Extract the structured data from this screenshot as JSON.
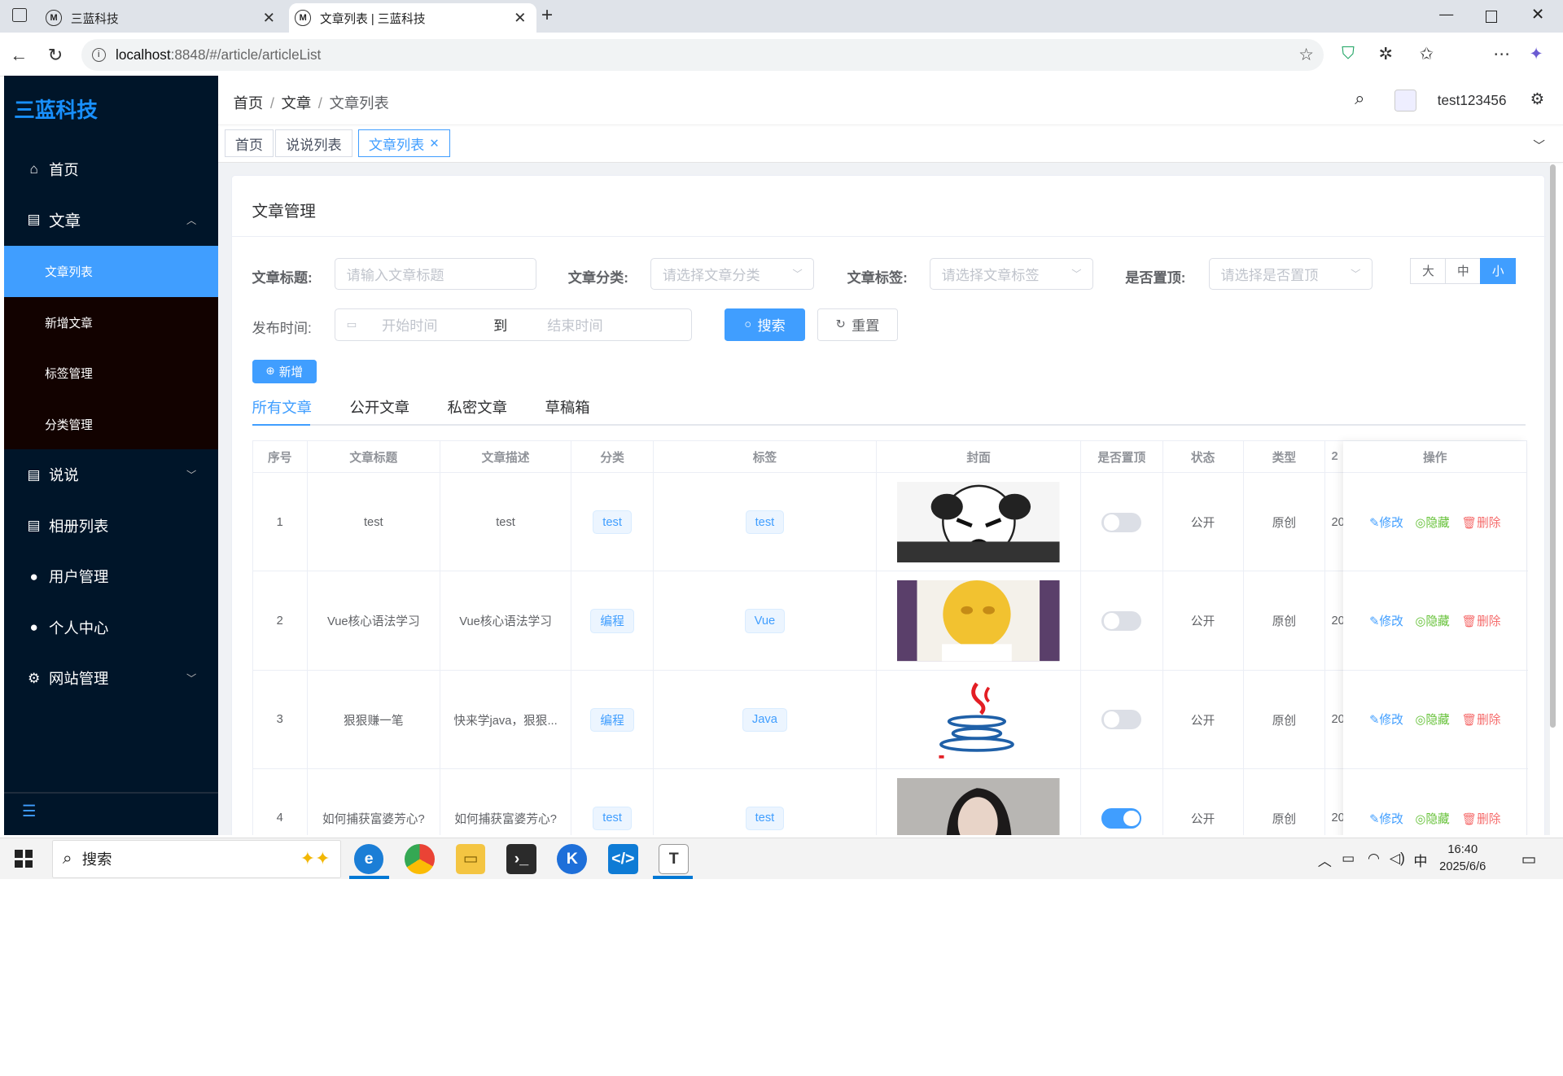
{
  "browser": {
    "tabs": [
      {
        "title": "三蓝科技",
        "fav": "M"
      },
      {
        "title": "文章列表 | 三蓝科技",
        "fav": "M"
      }
    ],
    "url_host": "localhost",
    "url_path": ":8848/#/article/articleList"
  },
  "sidebar": {
    "logo": "三蓝科技",
    "items": [
      {
        "label": "首页",
        "icon": "home-icon"
      },
      {
        "label": "文章",
        "icon": "document-icon"
      },
      {
        "label": "说说",
        "icon": "document-icon"
      },
      {
        "label": "相册列表",
        "icon": "document-icon"
      },
      {
        "label": "用户管理",
        "icon": "user-icon"
      },
      {
        "label": "个人中心",
        "icon": "user-icon"
      },
      {
        "label": "网站管理",
        "icon": "gear-icon"
      }
    ],
    "subitems": [
      "文章列表",
      "新增文章",
      "标签管理",
      "分类管理"
    ]
  },
  "header": {
    "breadcrumb": [
      "首页",
      "文章",
      "文章列表"
    ],
    "username": "test123456"
  },
  "tagsview": [
    "首页",
    "说说列表",
    "文章列表"
  ],
  "page": {
    "title": "文章管理",
    "filters": {
      "title_label": "文章标题:",
      "title_ph": "请输入文章标题",
      "category_label": "文章分类:",
      "category_ph": "请选择文章分类",
      "tag_label": "文章标签:",
      "tag_ph": "请选择文章标签",
      "top_label": "是否置顶:",
      "top_ph": "请选择是否置顶",
      "time_label": "发布时间:",
      "start_ph": "开始时间",
      "to": "到",
      "end_ph": "结束时间"
    },
    "size": [
      "大",
      "中",
      "小"
    ],
    "search_btn": "搜索",
    "reset_btn": "重置",
    "add_btn": "新增",
    "tabs": [
      "所有文章",
      "公开文章",
      "私密文章",
      "草稿箱"
    ],
    "columns": [
      "序号",
      "文章标题",
      "文章描述",
      "分类",
      "标签",
      "封面",
      "是否置顶",
      "状态",
      "类型",
      "2",
      "操作"
    ],
    "rows": [
      {
        "no": "1",
        "title": "test",
        "desc": "test",
        "category": "test",
        "tag": "test",
        "cover": "panda",
        "top": false,
        "status": "公开",
        "type": "原创",
        "date": "20"
      },
      {
        "no": "2",
        "title": "Vue核心语法学习",
        "desc": "Vue核心语法学习",
        "category": "编程",
        "tag": "Vue",
        "cover": "emoji",
        "top": false,
        "status": "公开",
        "type": "原创",
        "date": "20"
      },
      {
        "no": "3",
        "title": "狠狠赚一笔",
        "desc": "快来学java，狠狠...",
        "category": "编程",
        "tag": "Java",
        "cover": "java",
        "top": false,
        "status": "公开",
        "type": "原创",
        "date": "20"
      },
      {
        "no": "4",
        "title": "如何捕获富婆芳心?",
        "desc": "如何捕获富婆芳心?",
        "category": "test",
        "tag": "test",
        "cover": "portrait",
        "top": true,
        "status": "公开",
        "type": "原创",
        "date": "20"
      }
    ],
    "ops": {
      "edit": "修改",
      "hide": "隐藏",
      "del": "删除"
    }
  },
  "taskbar": {
    "search": "搜索",
    "ime": "中",
    "time": "16:40",
    "date": "2025/6/6"
  }
}
